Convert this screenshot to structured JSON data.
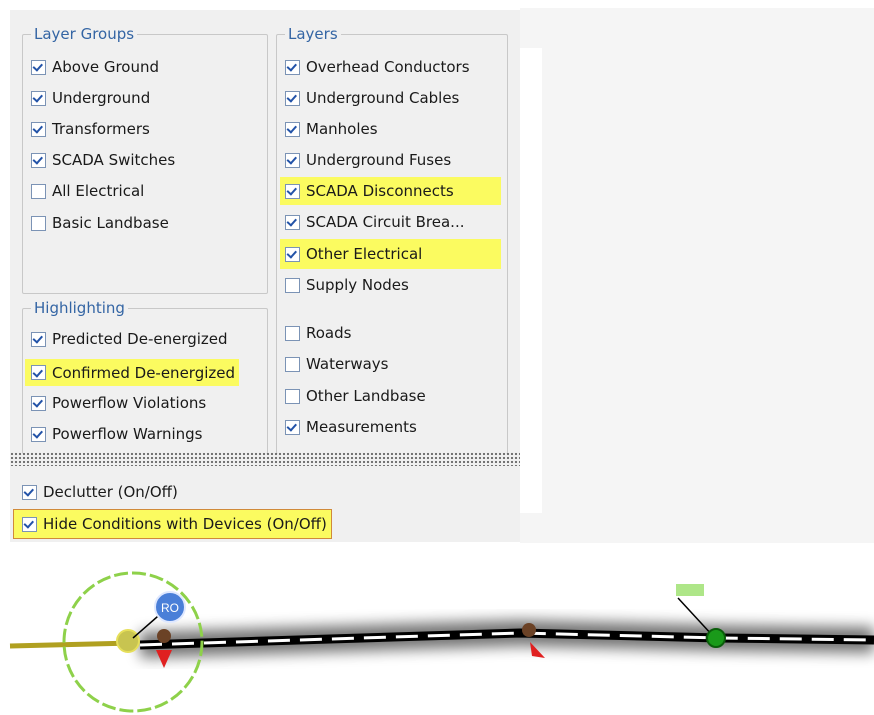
{
  "layer_groups": {
    "title": "Layer Groups",
    "items": [
      {
        "label": "Above Ground",
        "checked": true
      },
      {
        "label": "Underground",
        "checked": true
      },
      {
        "label": "Transformers",
        "checked": true
      },
      {
        "label": "SCADA Switches",
        "checked": true
      },
      {
        "label": "All Electrical",
        "checked": false
      },
      {
        "label": "Basic Landbase",
        "checked": false
      }
    ]
  },
  "highlighting": {
    "title": "Highlighting",
    "items": [
      {
        "label": "Predicted De-energized",
        "checked": true
      },
      {
        "label": "Confirmed De-energized",
        "checked": true,
        "highlighted": true
      },
      {
        "label": "Powerflow Violations",
        "checked": true
      },
      {
        "label": "Powerflow Warnings",
        "checked": true
      }
    ]
  },
  "layers": {
    "title": "Layers",
    "items": [
      {
        "label": "Overhead Conductors",
        "checked": true
      },
      {
        "label": "Underground Cables",
        "checked": true
      },
      {
        "label": "Manholes",
        "checked": true
      },
      {
        "label": "Underground Fuses",
        "checked": true
      },
      {
        "label": "SCADA Disconnects",
        "checked": true,
        "highlighted": true
      },
      {
        "label": "SCADA Circuit Brea...",
        "checked": true
      },
      {
        "label": "Other Electrical",
        "checked": true,
        "highlighted": true
      },
      {
        "label": "Supply Nodes",
        "checked": false
      },
      {
        "label": "Roads",
        "checked": false
      },
      {
        "label": "Waterways",
        "checked": false
      },
      {
        "label": "Other Landbase",
        "checked": false
      },
      {
        "label": "Measurements",
        "checked": true
      }
    ]
  },
  "options": {
    "declutter": {
      "label": "Declutter (On/Off)",
      "checked": true
    },
    "hide_conditions": {
      "label": "Hide Conditions with Devices (On/Off)",
      "checked": true,
      "highlighted": true
    }
  },
  "map": {
    "device_label": "RO",
    "colors": {
      "highlight": "#fbfb60",
      "legend_blue": "#3465a4",
      "ring_green": "#8ed14a",
      "conductor_olive": "#b0a020",
      "arrow_red": "#e02020"
    }
  }
}
